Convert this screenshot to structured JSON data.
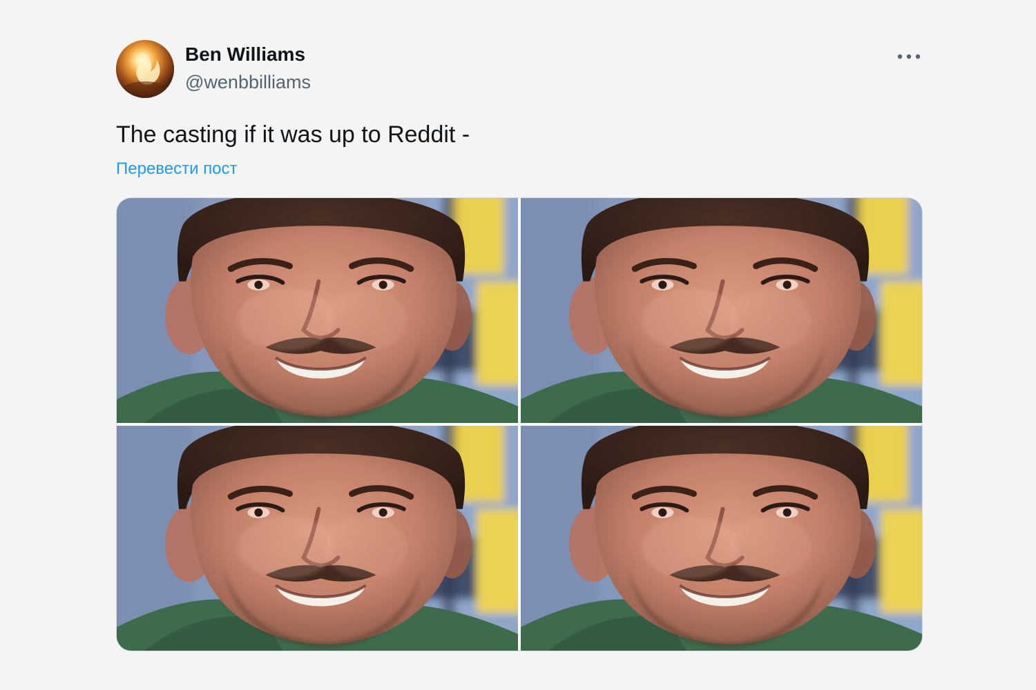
{
  "tweet": {
    "author": {
      "display_name": "Ben Williams",
      "handle": "@wenbbilliams",
      "avatar_icon": "fire-avatar-icon"
    },
    "more_icon": "more-dots-icon",
    "text": "The casting if it was up to Reddit -",
    "translate_label": "Перевести пост",
    "media": {
      "count": 4,
      "image_icon": "portrait-photo-icon"
    },
    "colors": {
      "link": "#1d9bf0",
      "text": "#0f1419",
      "secondary": "#536471",
      "background": "#f4f4f4"
    }
  }
}
